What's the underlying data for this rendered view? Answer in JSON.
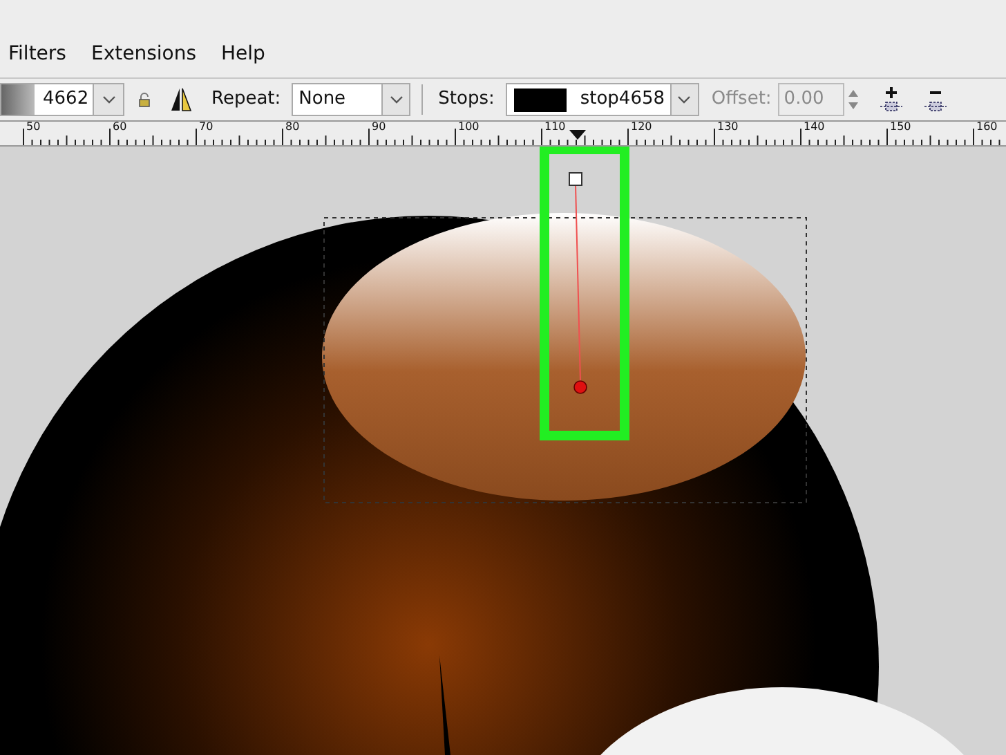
{
  "menu": [
    {
      "label": "Filters"
    },
    {
      "label": "Extensions"
    },
    {
      "label": "Help"
    }
  ],
  "toolbar": {
    "gradient": {
      "value": "4662"
    },
    "repeat": {
      "label": "Repeat:",
      "value": "None"
    },
    "stops": {
      "label": "Stops:",
      "value": "stop4658",
      "color": "#000000"
    },
    "offset": {
      "label": "Offset:",
      "value": "0.00",
      "disabled": true
    }
  },
  "ruler": {
    "labels": [
      "50",
      "60",
      "70",
      "80",
      "90",
      "100",
      "110",
      "120",
      "130",
      "140",
      "150",
      "160"
    ]
  }
}
